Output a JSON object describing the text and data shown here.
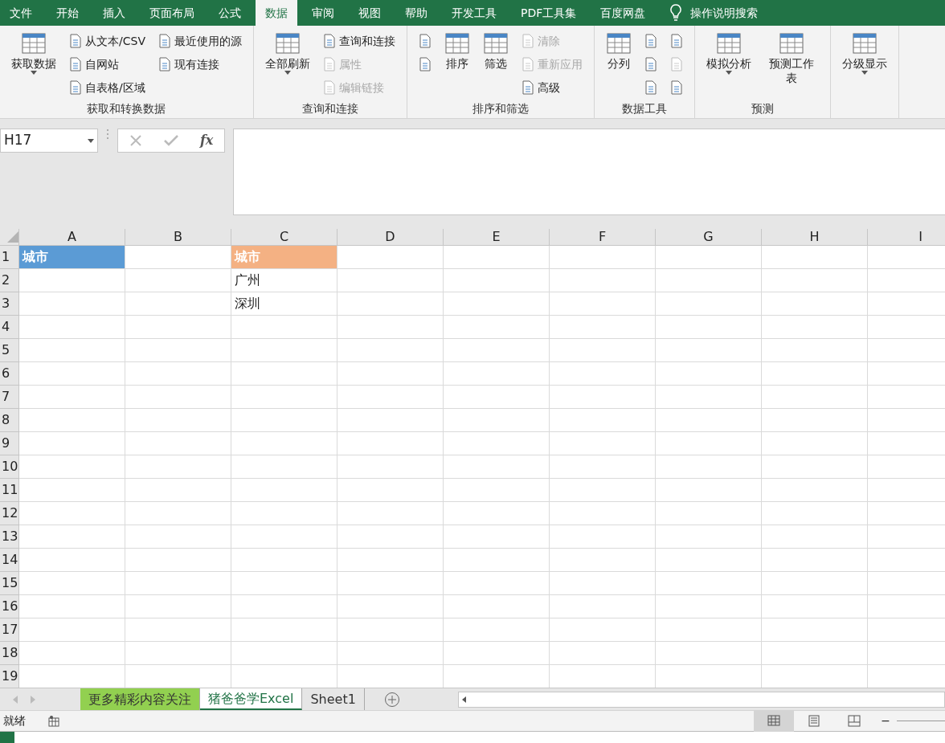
{
  "menu_tabs": [
    {
      "label": "文件",
      "selected": false
    },
    {
      "label": "开始",
      "selected": false
    },
    {
      "label": "插入",
      "selected": false
    },
    {
      "label": "页面布局",
      "selected": false
    },
    {
      "label": "公式",
      "selected": false
    },
    {
      "label": "数据",
      "selected": true
    },
    {
      "label": "审阅",
      "selected": false
    },
    {
      "label": "视图",
      "selected": false
    },
    {
      "label": "帮助",
      "selected": false
    },
    {
      "label": "开发工具",
      "selected": false
    },
    {
      "label": "PDF工具集",
      "selected": false
    },
    {
      "label": "百度网盘",
      "selected": false
    }
  ],
  "tell_me": "操作说明搜索",
  "ribbon_groups": [
    {
      "title": "获取和转换数据",
      "columns": [
        {
          "kind": "large",
          "items": [
            {
              "label": "获取数据",
              "disabled": false,
              "dropdown": true
            }
          ]
        },
        {
          "kind": "stack",
          "items": [
            {
              "label": "从文本/CSV",
              "disabled": false
            },
            {
              "label": "自网站",
              "disabled": false
            },
            {
              "label": "自表格/区域",
              "disabled": false
            }
          ]
        },
        {
          "kind": "stack",
          "items": [
            {
              "label": "最近使用的源",
              "disabled": false
            },
            {
              "label": "现有连接",
              "disabled": false
            }
          ]
        }
      ]
    },
    {
      "columns": [
        {
          "kind": "large",
          "items": [
            {
              "label": "全部刷新",
              "disabled": false,
              "dropdown": true
            }
          ]
        },
        {
          "kind": "stack",
          "items": [
            {
              "label": "查询和连接",
              "disabled": false
            },
            {
              "label": "属性",
              "disabled": true
            },
            {
              "label": "编辑链接",
              "disabled": true
            }
          ]
        }
      ],
      "title": "查询和连接"
    },
    {
      "title": "排序和筛选",
      "columns": [
        {
          "kind": "stack",
          "items": [
            {
              "disabled": false
            },
            {
              "disabled": false
            }
          ]
        },
        {
          "kind": "large",
          "items": [
            {
              "label": "排序",
              "disabled": false,
              "dropdown": false
            }
          ]
        },
        {
          "kind": "large",
          "items": [
            {
              "label": "筛选",
              "disabled": false,
              "dropdown": false
            }
          ]
        },
        {
          "kind": "stack",
          "items": [
            {
              "label": "清除",
              "disabled": true
            },
            {
              "label": "重新应用",
              "disabled": true
            },
            {
              "label": "高级",
              "disabled": false
            }
          ]
        }
      ]
    },
    {
      "title": "数据工具",
      "columns": [
        {
          "kind": "large",
          "items": [
            {
              "label": "分列",
              "disabled": false,
              "dropdown": false
            }
          ]
        },
        {
          "kind": "stack",
          "items": [
            {
              "disabled": false
            },
            {
              "disabled": false
            },
            {
              "disabled": false
            }
          ]
        },
        {
          "kind": "stack",
          "items": [
            {
              "disabled": false
            },
            {
              "disabled": true
            },
            {
              "disabled": false
            }
          ]
        }
      ]
    },
    {
      "title": "预测",
      "columns": [
        {
          "kind": "large",
          "items": [
            {
              "label": "模拟分析",
              "disabled": false,
              "dropdown": true
            }
          ]
        },
        {
          "kind": "large",
          "items": [
            {
              "label": "预测工作表",
              "disabled": false,
              "dropdown": false
            }
          ]
        }
      ]
    },
    {
      "columns": [
        {
          "kind": "large",
          "items": [
            {
              "label": "分级显示",
              "disabled": false,
              "dropdown": true
            }
          ]
        }
      ]
    }
  ],
  "name_box": "H17",
  "function_label": "fx",
  "columns": [
    "A",
    "B",
    "C",
    "D",
    "E",
    "F",
    "G",
    "H",
    "I"
  ],
  "rows": [
    {
      "number": "1",
      "cells": {
        "A": {
          "text": "城市",
          "color": "#5b9bd5",
          "bold": true
        },
        "C": {
          "text": "城市",
          "color": "#f4b183",
          "bold": true
        }
      }
    },
    {
      "number": "2",
      "cells": {
        "C": {
          "text": "广州",
          "bold": false
        }
      }
    },
    {
      "number": "3",
      "cells": {
        "C": {
          "text": "深圳",
          "bold": false
        }
      }
    },
    {
      "number": "4"
    },
    {
      "number": "5"
    },
    {
      "number": "6"
    },
    {
      "number": "7"
    },
    {
      "number": "8"
    },
    {
      "number": "9"
    },
    {
      "number": "10"
    },
    {
      "number": "11"
    },
    {
      "number": "12"
    },
    {
      "number": "13"
    },
    {
      "number": "14"
    },
    {
      "number": "15"
    },
    {
      "number": "16"
    },
    {
      "number": "17"
    },
    {
      "number": "18"
    },
    {
      "number": "19"
    }
  ],
  "sheet_tabs": [
    {
      "label": "更多精彩内容关注",
      "selected": false,
      "color": "#92d050"
    },
    {
      "label": "猪爸爸学Excel",
      "selected": true
    },
    {
      "label": "Sheet1",
      "selected": false
    }
  ],
  "status": "就绪",
  "views": [
    {
      "selected": true
    },
    {
      "selected": false
    },
    {
      "selected": false
    }
  ],
  "zoom_out": "−"
}
